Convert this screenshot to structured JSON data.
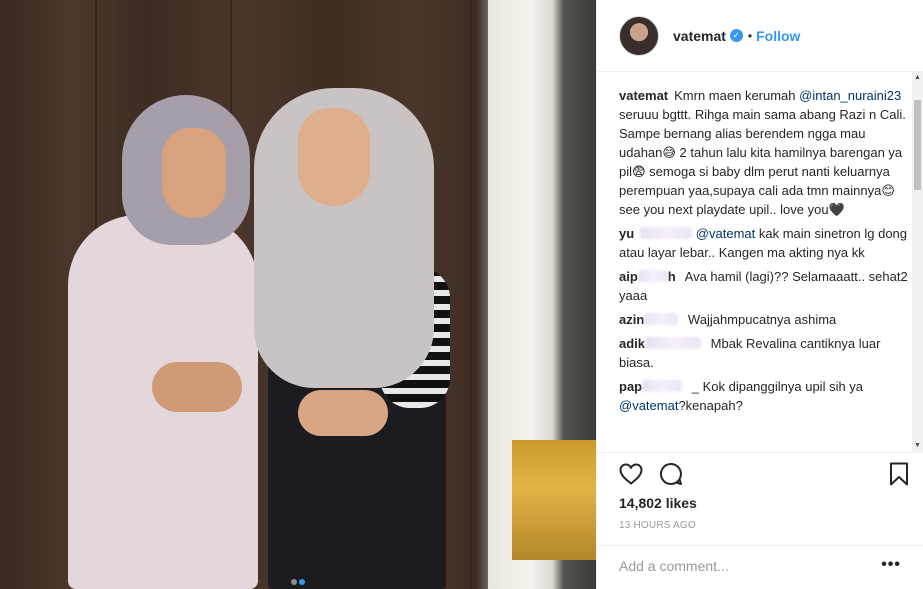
{
  "post": {
    "username": "vatemat",
    "verified_badge": "✓",
    "bullet": "•",
    "follow_label": "Follow"
  },
  "comments": [
    {
      "user": "vatemat",
      "text_pre": "Kmrn maen kerumah",
      "mention": "@intan_nuraini23",
      "text_post": "seruuu bgttt. Rihga main sama abang Razi n Cali. Sampe bernang alias berendem ngga mau udahan😅 2 tahun lalu kita hamilnya barengan ya pil😨 semoga si baby dlm perut nanti keluarnya perempuan yaa,supaya cali ada tmn mainnya😊 see you next playdate upil.. love you🖤"
    },
    {
      "user": "yu",
      "mention": "@vatemat",
      "text": "kak main sinetron lg dong atau layar lebar.. Kangen ma akting nya kk"
    },
    {
      "user": "aip",
      "user_tail": "h",
      "text": "Ava hamil (lagi)?? Selamaaatt.. sehat2 yaaa"
    },
    {
      "user": "azin",
      "text": "Wajjahmpucatnya ashima"
    },
    {
      "user": "adik",
      "text": "Mbak Revalina cantiknya luar biasa."
    },
    {
      "user": "pap",
      "text": "_ Kok dipanggilnya upil sih ya",
      "mention_next": "@vatemat",
      "text_end": "?kenapah?"
    }
  ],
  "likes": "14,802 likes",
  "time": "13 HOURS AGO",
  "add_comment_placeholder": "Add a comment...",
  "more_label": "•••",
  "icons": [
    "heart-icon",
    "comment-icon",
    "bookmark-icon",
    "more-icon"
  ],
  "colors": {
    "accent": "#3897f0",
    "text": "#262626",
    "muted": "#999999",
    "mention": "#003569"
  }
}
